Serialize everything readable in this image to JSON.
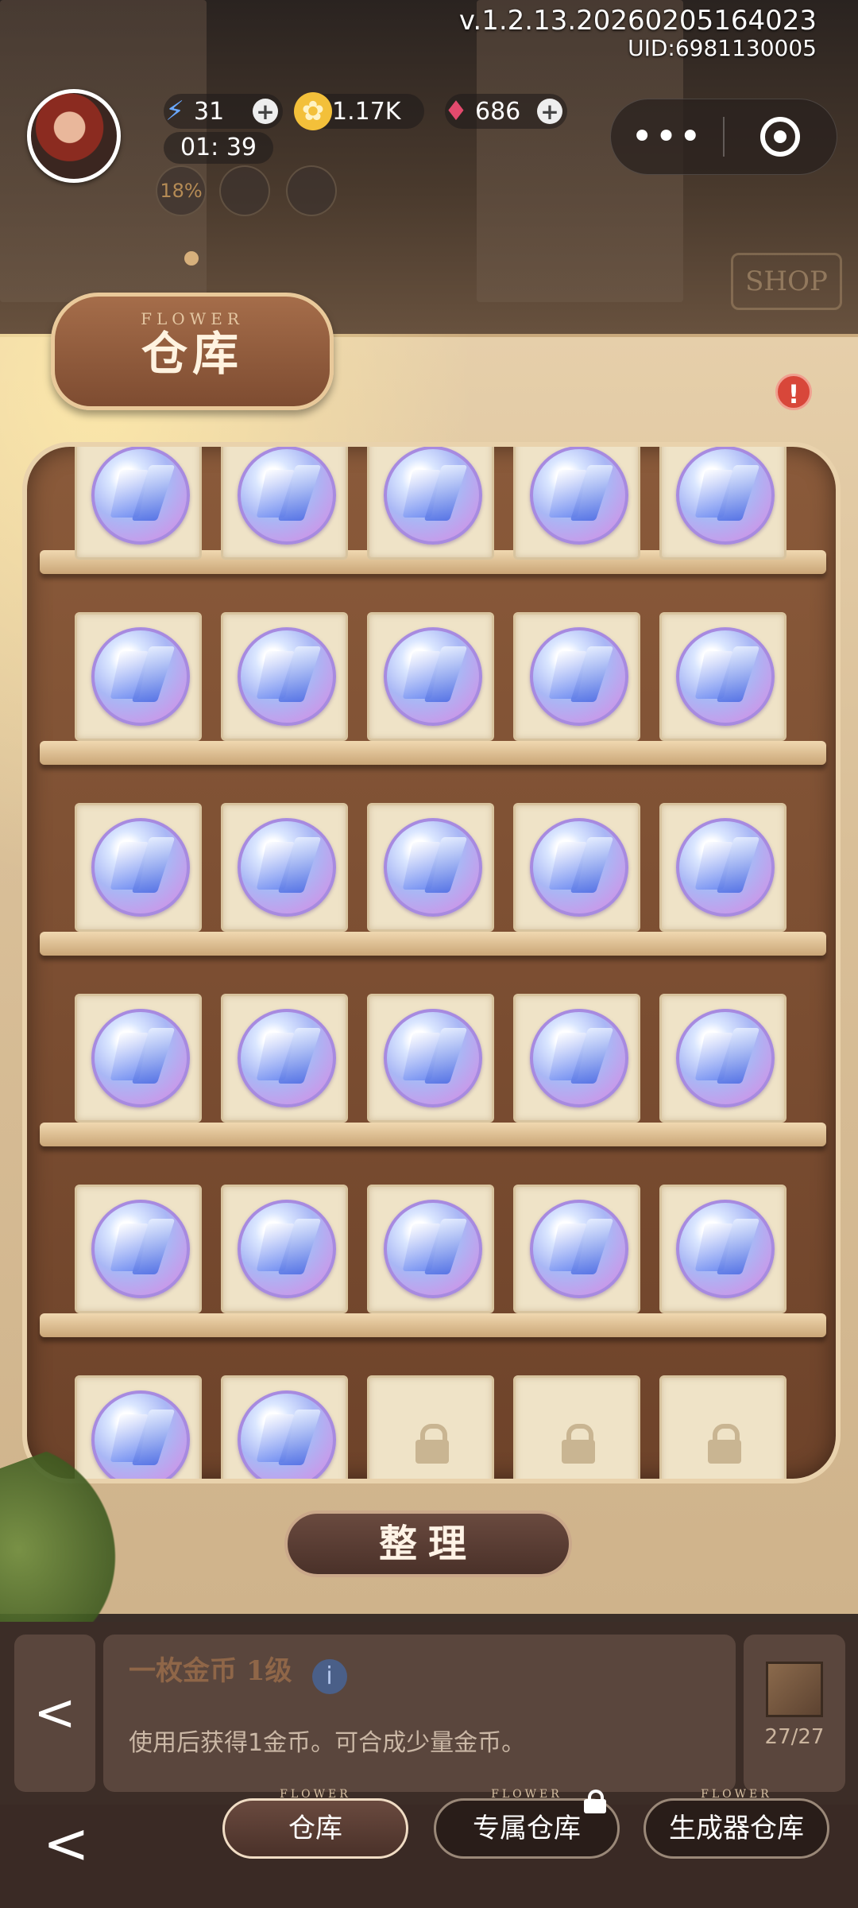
{
  "header": {
    "version": "v.1.2.13.20260205164023",
    "uid": "UID:6981130005",
    "energy": "31",
    "timer": "01: 39",
    "coins": "1.17K",
    "gems": "686",
    "event_progress": "18%",
    "energy_icon": "lightning-icon",
    "coin_icon": "gold-coin-icon",
    "gem_icon": "ruby-gem-icon",
    "shop_sign": "SHOP"
  },
  "sign": {
    "subtitle": "FLOWER",
    "title": "仓库"
  },
  "warehouse": {
    "item_icon": "energy-crystal-orb",
    "rows": [
      [
        "energy",
        "energy",
        "energy",
        "energy",
        "energy"
      ],
      [
        "energy",
        "energy",
        "energy",
        "energy",
        "energy"
      ],
      [
        "energy",
        "energy",
        "energy",
        "energy",
        "energy"
      ],
      [
        "energy",
        "energy",
        "energy",
        "energy",
        "energy"
      ],
      [
        "energy",
        "energy",
        "energy",
        "energy",
        "energy"
      ],
      [
        "energy",
        "energy",
        "locked",
        "locked",
        "locked"
      ]
    ]
  },
  "sort_button": "整理",
  "item_info": {
    "name": "一枚金币 1级",
    "description": "使用后获得1金币。可合成少量金币。",
    "storage_count": "27/27"
  },
  "tabs": [
    {
      "label": "仓库",
      "sub": "FLOWER",
      "active": true,
      "locked": false
    },
    {
      "label": "专属仓库",
      "sub": "FLOWER",
      "active": false,
      "locked": true
    },
    {
      "label": "生成器仓库",
      "sub": "FLOWER",
      "active": false,
      "locked": false
    }
  ],
  "colors": {
    "cabinet": "#d9bf98",
    "shelf_wood": "#7a4c30",
    "alert": "#d8473a"
  }
}
